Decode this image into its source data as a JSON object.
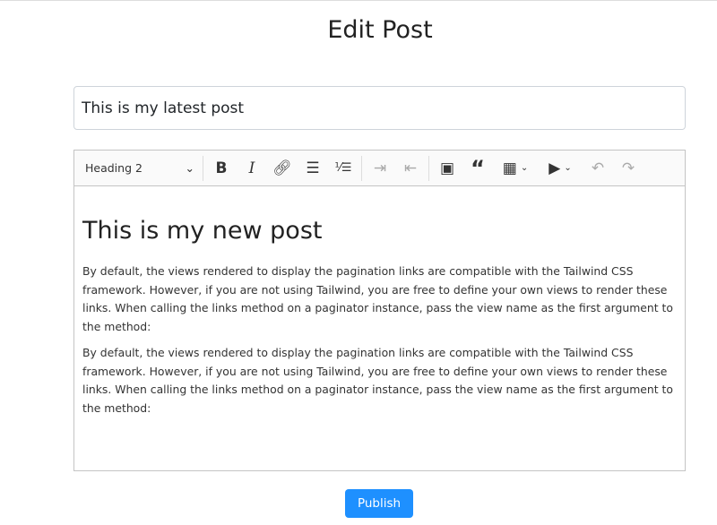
{
  "page": {
    "title": "Edit Post"
  },
  "form": {
    "title_value": "This is my latest post",
    "publish_label": "Publish"
  },
  "editor": {
    "heading_select": "Heading 2",
    "toolbar": [
      "bold-icon",
      "italic-icon",
      "link-icon",
      "bulleted-list-icon",
      "numbered-list-icon",
      "indent-icon",
      "outdent-icon",
      "image-icon",
      "quote-icon",
      "table-icon",
      "media-icon",
      "undo-icon",
      "redo-icon"
    ],
    "heading": "This is my new post",
    "paragraphs": [
      "By default, the views rendered to display the pagination links are compatible with the Tailwind CSS framework. However, if you are not using Tailwind, you are free to define your own views to render these links. When calling the links method on a paginator instance, pass the view name as the first argument to the method:",
      "By default, the views rendered to display the pagination links are compatible with the Tailwind CSS framework. However, if you are not using Tailwind, you are free to define your own views to render these links. When calling the links method on a paginator instance, pass the view name as the first argument to the method:"
    ]
  },
  "colors": {
    "accent": "#1e90ff"
  }
}
